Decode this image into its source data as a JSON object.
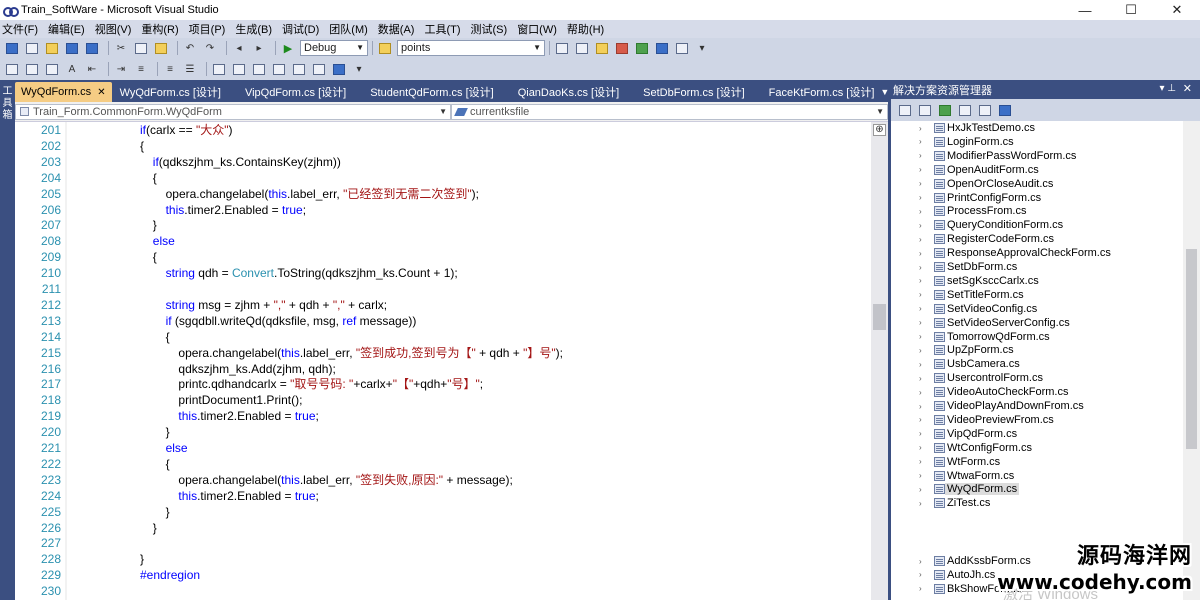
{
  "window": {
    "title": "Train_SoftWare - Microsoft Visual Studio",
    "minimize": "—",
    "maximize": "☐",
    "close": "✕"
  },
  "menu": [
    "文件(F)",
    "编辑(E)",
    "视图(V)",
    "重构(R)",
    "项目(P)",
    "生成(B)",
    "调试(D)",
    "团队(M)",
    "数据(A)",
    "工具(T)",
    "测试(S)",
    "窗口(W)",
    "帮助(H)"
  ],
  "toolbar": {
    "configuration": "Debug",
    "find_value": "points"
  },
  "left_dock": {
    "label": "工具箱"
  },
  "tabs": [
    {
      "label": "WyQdForm.cs",
      "active": true
    },
    {
      "label": "WyQdForm.cs [设计]",
      "active": false
    },
    {
      "label": "VipQdForm.cs [设计]",
      "active": false
    },
    {
      "label": "StudentQdForm.cs [设计]",
      "active": false
    },
    {
      "label": "QianDaoKs.cs [设计]",
      "active": false
    },
    {
      "label": "SetDbForm.cs [设计]",
      "active": false
    },
    {
      "label": "FaceKtForm.cs [设计]",
      "active": false
    }
  ],
  "navbar": {
    "class_combo": "Train_Form.CommonForm.WyQdForm",
    "member_combo": "currentksfile"
  },
  "code_lines": [
    {
      "num": "201",
      "indent": 0,
      "tokens": [
        [
          "kw",
          "if"
        ],
        [
          "",
          "(carlx == "
        ],
        [
          "str",
          "\"大众\""
        ],
        [
          "",
          ")"
        ]
      ]
    },
    {
      "num": "202",
      "indent": 0,
      "tokens": [
        [
          "",
          "{"
        ]
      ]
    },
    {
      "num": "203",
      "indent": 1,
      "tokens": [
        [
          "kw",
          "if"
        ],
        [
          "",
          ""
        ],
        [
          "",
          "(qdkszjhm_ks.ContainsKey(zjhm))"
        ]
      ]
    },
    {
      "num": "204",
      "indent": 1,
      "tokens": [
        [
          "",
          "{"
        ]
      ]
    },
    {
      "num": "205",
      "indent": 2,
      "tokens": [
        [
          "",
          "opera.changelabel("
        ],
        [
          "kw",
          "this"
        ],
        [
          "",
          ".label_err, "
        ],
        [
          "str",
          "\"已经签到无需二次签到\""
        ],
        [
          "",
          ");"
        ]
      ]
    },
    {
      "num": "206",
      "indent": 2,
      "tokens": [
        [
          "kw",
          "this"
        ],
        [
          "",
          ".timer2.Enabled = "
        ],
        [
          "kw",
          "true"
        ],
        [
          "",
          ";"
        ]
      ]
    },
    {
      "num": "207",
      "indent": 1,
      "tokens": [
        [
          "",
          "}"
        ]
      ]
    },
    {
      "num": "208",
      "indent": 1,
      "tokens": [
        [
          "kw",
          "else"
        ]
      ]
    },
    {
      "num": "209",
      "indent": 1,
      "tokens": [
        [
          "",
          "{"
        ]
      ]
    },
    {
      "num": "210",
      "indent": 2,
      "tokens": [
        [
          "kw",
          "string"
        ],
        [
          "",
          " qdh = "
        ],
        [
          "ty",
          "Convert"
        ],
        [
          "",
          ".ToString(qdkszjhm_ks.Count + 1);"
        ]
      ]
    },
    {
      "num": "211",
      "indent": 0,
      "tokens": []
    },
    {
      "num": "212",
      "indent": 2,
      "tokens": [
        [
          "kw",
          "string"
        ],
        [
          "",
          " msg = zjhm + "
        ],
        [
          "str",
          "\",\""
        ],
        [
          "",
          " + qdh + "
        ],
        [
          "str",
          "\",\""
        ],
        [
          "",
          " + carlx;"
        ]
      ]
    },
    {
      "num": "213",
      "indent": 2,
      "tokens": [
        [
          "kw",
          "if"
        ],
        [
          "",
          " (sgqdbll.writeQd(qdksfile, msg, "
        ],
        [
          "kw",
          "ref"
        ],
        [
          "",
          " message))"
        ]
      ]
    },
    {
      "num": "214",
      "indent": 2,
      "tokens": [
        [
          "",
          "{"
        ]
      ]
    },
    {
      "num": "215",
      "indent": 3,
      "tokens": [
        [
          "",
          "opera.changelabel("
        ],
        [
          "kw",
          "this"
        ],
        [
          "",
          ".label_err, "
        ],
        [
          "str",
          "\"签到成功,签到号为【\""
        ],
        [
          "",
          " + qdh + "
        ],
        [
          "str",
          "\"】号\""
        ],
        [
          "",
          ");"
        ]
      ]
    },
    {
      "num": "216",
      "indent": 3,
      "tokens": [
        [
          "",
          "qdkszjhm_ks.Add(zjhm, qdh);"
        ]
      ]
    },
    {
      "num": "217",
      "indent": 3,
      "tokens": [
        [
          "",
          "printc.qdhandcarlx = "
        ],
        [
          "str",
          "\"取号号码: \""
        ],
        [
          "",
          "+carlx+"
        ],
        [
          "str",
          "\"【\""
        ],
        [
          "",
          "+qdh+"
        ],
        [
          "str",
          "\"号】\""
        ],
        [
          "",
          ";"
        ]
      ]
    },
    {
      "num": "218",
      "indent": 3,
      "tokens": [
        [
          "",
          "printDocument1.Print();"
        ]
      ]
    },
    {
      "num": "219",
      "indent": 3,
      "tokens": [
        [
          "kw",
          "this"
        ],
        [
          "",
          ".timer2.Enabled = "
        ],
        [
          "kw",
          "true"
        ],
        [
          "",
          ";"
        ]
      ]
    },
    {
      "num": "220",
      "indent": 2,
      "tokens": [
        [
          "",
          "}"
        ]
      ]
    },
    {
      "num": "221",
      "indent": 2,
      "tokens": [
        [
          "kw",
          "else"
        ]
      ]
    },
    {
      "num": "222",
      "indent": 2,
      "tokens": [
        [
          "",
          "{"
        ]
      ]
    },
    {
      "num": "223",
      "indent": 3,
      "tokens": [
        [
          "",
          "opera.changelabel("
        ],
        [
          "kw",
          "this"
        ],
        [
          "",
          ".label_err, "
        ],
        [
          "str",
          "\"签到失败,原因:\""
        ],
        [
          "",
          " + message);"
        ]
      ]
    },
    {
      "num": "224",
      "indent": 3,
      "tokens": [
        [
          "kw",
          "this"
        ],
        [
          "",
          ".timer2.Enabled = "
        ],
        [
          "kw",
          "true"
        ],
        [
          "",
          ";"
        ]
      ]
    },
    {
      "num": "225",
      "indent": 2,
      "tokens": [
        [
          "",
          "}"
        ]
      ]
    },
    {
      "num": "226",
      "indent": 1,
      "tokens": [
        [
          "",
          "}"
        ]
      ]
    },
    {
      "num": "227",
      "indent": 0,
      "tokens": []
    },
    {
      "num": "228",
      "indent": 0,
      "tokens": [
        [
          "",
          "}"
        ]
      ]
    },
    {
      "num": "229",
      "indent": 0,
      "tokens": [
        [
          "rg",
          "#endregion"
        ]
      ]
    },
    {
      "num": "230",
      "indent": 0,
      "tokens": []
    }
  ],
  "solution_explorer": {
    "title": "解决方案资源管理器",
    "pin": "▾ ⊥",
    "close": "✕",
    "items": [
      {
        "label": "HxJkTestDemo.cs"
      },
      {
        "label": "LoginForm.cs"
      },
      {
        "label": "ModifierPassWordForm.cs"
      },
      {
        "label": "OpenAuditForm.cs"
      },
      {
        "label": "OpenOrCloseAudit.cs"
      },
      {
        "label": "PrintConfigForm.cs"
      },
      {
        "label": "ProcessFrom.cs"
      },
      {
        "label": "QueryConditionForm.cs"
      },
      {
        "label": "RegisterCodeForm.cs"
      },
      {
        "label": "ResponseApprovalCheckForm.cs"
      },
      {
        "label": "SetDbForm.cs"
      },
      {
        "label": "setSgKsccCarlx.cs"
      },
      {
        "label": "SetTitleForm.cs"
      },
      {
        "label": "SetVideoConfig.cs"
      },
      {
        "label": "SetVideoServerConfig.cs"
      },
      {
        "label": "TomorrowQdForm.cs"
      },
      {
        "label": "UpZpForm.cs"
      },
      {
        "label": "UsbCamera.cs"
      },
      {
        "label": "UsercontrolForm.cs"
      },
      {
        "label": "VideoAutoCheckForm.cs"
      },
      {
        "label": "VideoPlayAndDownFrom.cs"
      },
      {
        "label": "VideoPreviewFrom.cs"
      },
      {
        "label": "VipQdForm.cs"
      },
      {
        "label": "WtConfigForm.cs"
      },
      {
        "label": "WtForm.cs"
      },
      {
        "label": "WtwaForm.cs"
      },
      {
        "label": "WyQdForm.cs",
        "selected": true
      },
      {
        "label": "ZiTest.cs"
      }
    ],
    "items_bottom": [
      {
        "label": "AddKssbForm.cs"
      },
      {
        "label": "AutoJh.cs"
      },
      {
        "label": "BkShowForm.cs"
      }
    ]
  },
  "watermark": {
    "activate": "激活 Windows",
    "brand_cn": "源码海洋网",
    "brand_url": "www.codehy.com"
  },
  "colors": {
    "keyword": "#0000ff",
    "string": "#a31515",
    "type": "#2b91af",
    "line_number": "#2b91af",
    "chrome_dark": "#3b4f81",
    "active_tab": "#f5cc84"
  }
}
